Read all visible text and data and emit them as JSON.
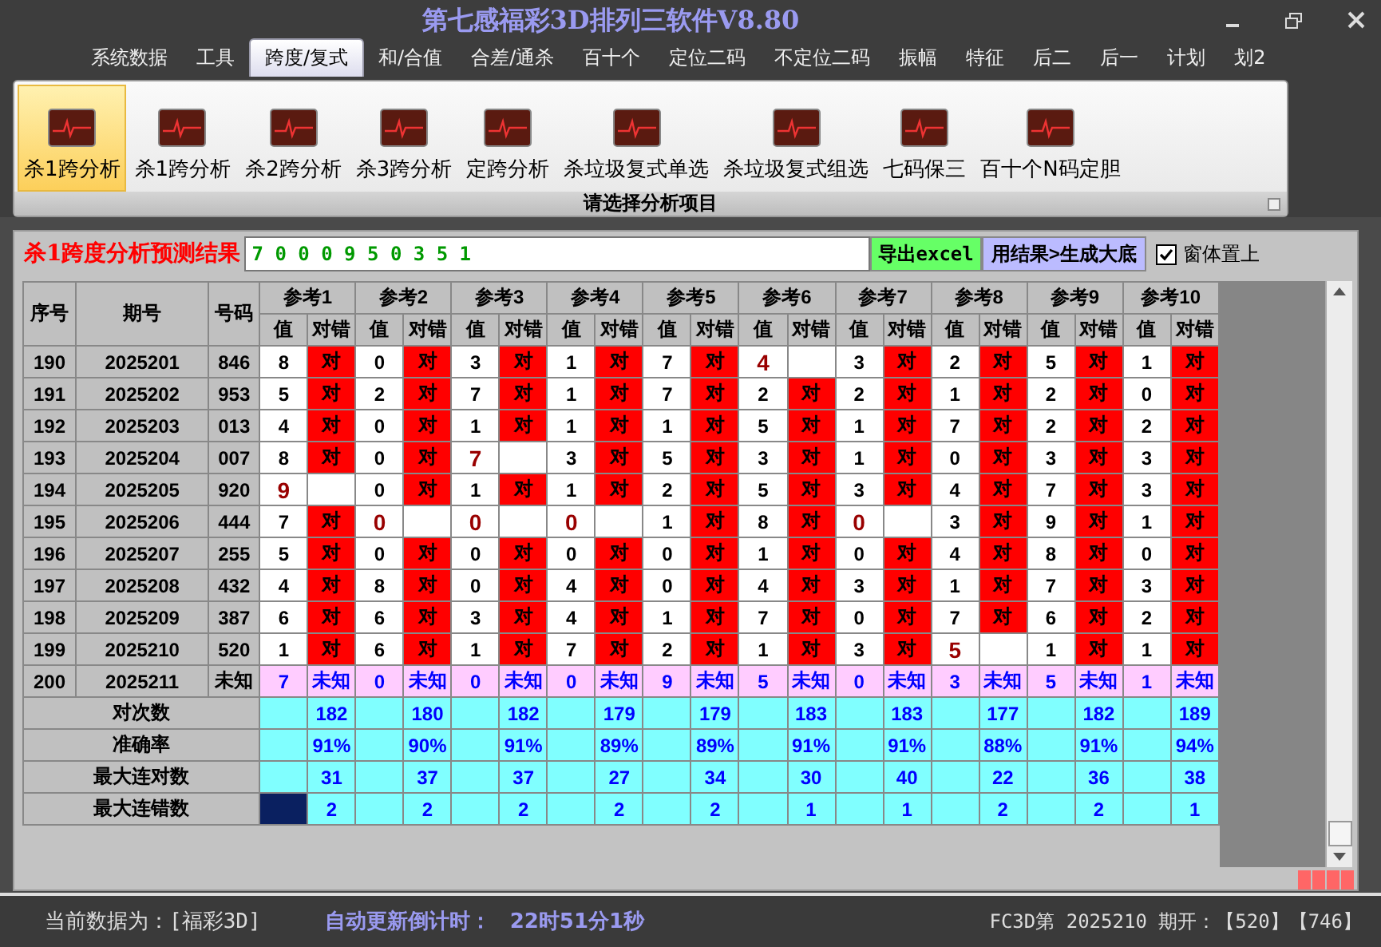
{
  "window": {
    "title": "第七感福彩3D排列三软件V8.80"
  },
  "menu": [
    {
      "label": "系统数据",
      "selected": false
    },
    {
      "label": "工具",
      "selected": false
    },
    {
      "label": "跨度/复式",
      "selected": true
    },
    {
      "label": "和/合值",
      "selected": false
    },
    {
      "label": "合差/通杀",
      "selected": false
    },
    {
      "label": "百十个",
      "selected": false
    },
    {
      "label": "定位二码",
      "selected": false
    },
    {
      "label": "不定位二码",
      "selected": false
    },
    {
      "label": "振幅",
      "selected": false
    },
    {
      "label": "特征",
      "selected": false
    },
    {
      "label": "后二",
      "selected": false
    },
    {
      "label": "后一",
      "selected": false
    },
    {
      "label": "计划",
      "selected": false
    },
    {
      "label": "划2",
      "selected": false
    }
  ],
  "ribbon": {
    "items": [
      {
        "label": "杀1跨分析",
        "selected": true
      },
      {
        "label": "杀1跨分析",
        "selected": false
      },
      {
        "label": "杀2跨分析",
        "selected": false
      },
      {
        "label": "杀3跨分析",
        "selected": false
      },
      {
        "label": "定跨分析",
        "selected": false
      },
      {
        "label": "杀垃圾复式单选",
        "selected": false
      },
      {
        "label": "杀垃圾复式组选",
        "selected": false
      },
      {
        "label": "七码保三",
        "selected": false
      },
      {
        "label": "百十个N码定胆",
        "selected": false
      }
    ],
    "group_label": "请选择分析项目"
  },
  "result": {
    "label": "杀1跨度分析预测结果",
    "value": "7 0 0 0 9 5 0 3 5 1",
    "export_button": "导出excel",
    "generate_button": "用结果>生成大底",
    "on_top": {
      "label": "窗体置上",
      "checked": true
    }
  },
  "table": {
    "columns": [
      "序号",
      "期号",
      "号码"
    ],
    "group_columns": [
      {
        "label": "参考1",
        "sub": [
          "值",
          "对错"
        ]
      },
      {
        "label": "参考2",
        "sub": [
          "值",
          "对错"
        ]
      },
      {
        "label": "参考3",
        "sub": [
          "值",
          "对错"
        ]
      },
      {
        "label": "参考4",
        "sub": [
          "值",
          "对错"
        ]
      },
      {
        "label": "参考5",
        "sub": [
          "值",
          "对错"
        ]
      },
      {
        "label": "参考6",
        "sub": [
          "值",
          "对错"
        ]
      },
      {
        "label": "参考7",
        "sub": [
          "值",
          "对错"
        ]
      },
      {
        "label": "参考8",
        "sub": [
          "值",
          "对错"
        ]
      },
      {
        "label": "参考9",
        "sub": [
          "值",
          "对错"
        ]
      },
      {
        "label": "参考10",
        "sub": [
          "值",
          "对错"
        ]
      }
    ],
    "rows": [
      {
        "seq": "190",
        "period": "2025201",
        "number": "846",
        "kind": "done",
        "cells": [
          {
            "v": "8",
            "mark": "对"
          },
          {
            "v": "0",
            "mark": "对"
          },
          {
            "v": "3",
            "mark": "对"
          },
          {
            "v": "1",
            "mark": "对"
          },
          {
            "v": "7",
            "mark": "对"
          },
          {
            "v": "4",
            "miss": true
          },
          {
            "v": "3",
            "mark": "对"
          },
          {
            "v": "2",
            "mark": "对"
          },
          {
            "v": "5",
            "mark": "对"
          },
          {
            "v": "1",
            "mark": "对"
          }
        ]
      },
      {
        "seq": "191",
        "period": "2025202",
        "number": "953",
        "kind": "done",
        "cells": [
          {
            "v": "5",
            "mark": "对"
          },
          {
            "v": "2",
            "mark": "对"
          },
          {
            "v": "7",
            "mark": "对"
          },
          {
            "v": "1",
            "mark": "对"
          },
          {
            "v": "7",
            "mark": "对"
          },
          {
            "v": "2",
            "mark": "对"
          },
          {
            "v": "2",
            "mark": "对"
          },
          {
            "v": "1",
            "mark": "对"
          },
          {
            "v": "2",
            "mark": "对"
          },
          {
            "v": "0",
            "mark": "对"
          }
        ]
      },
      {
        "seq": "192",
        "period": "2025203",
        "number": "013",
        "kind": "done",
        "cells": [
          {
            "v": "4",
            "mark": "对"
          },
          {
            "v": "0",
            "mark": "对"
          },
          {
            "v": "1",
            "mark": "对"
          },
          {
            "v": "1",
            "mark": "对"
          },
          {
            "v": "1",
            "mark": "对"
          },
          {
            "v": "5",
            "mark": "对"
          },
          {
            "v": "1",
            "mark": "对"
          },
          {
            "v": "7",
            "mark": "对"
          },
          {
            "v": "2",
            "mark": "对"
          },
          {
            "v": "2",
            "mark": "对"
          }
        ]
      },
      {
        "seq": "193",
        "period": "2025204",
        "number": "007",
        "kind": "done",
        "cells": [
          {
            "v": "8",
            "mark": "对"
          },
          {
            "v": "0",
            "mark": "对"
          },
          {
            "v": "7",
            "miss": true
          },
          {
            "v": "3",
            "mark": "对"
          },
          {
            "v": "5",
            "mark": "对"
          },
          {
            "v": "3",
            "mark": "对"
          },
          {
            "v": "1",
            "mark": "对"
          },
          {
            "v": "0",
            "mark": "对"
          },
          {
            "v": "3",
            "mark": "对"
          },
          {
            "v": "3",
            "mark": "对"
          }
        ]
      },
      {
        "seq": "194",
        "period": "2025205",
        "number": "920",
        "kind": "done",
        "cells": [
          {
            "v": "9",
            "miss": true
          },
          {
            "v": "0",
            "mark": "对"
          },
          {
            "v": "1",
            "mark": "对"
          },
          {
            "v": "1",
            "mark": "对"
          },
          {
            "v": "2",
            "mark": "对"
          },
          {
            "v": "5",
            "mark": "对"
          },
          {
            "v": "3",
            "mark": "对"
          },
          {
            "v": "4",
            "mark": "对"
          },
          {
            "v": "7",
            "mark": "对"
          },
          {
            "v": "3",
            "mark": "对"
          }
        ]
      },
      {
        "seq": "195",
        "period": "2025206",
        "number": "444",
        "kind": "done",
        "cells": [
          {
            "v": "7",
            "mark": "对"
          },
          {
            "v": "0",
            "miss": true
          },
          {
            "v": "0",
            "miss": true
          },
          {
            "v": "0",
            "miss": true
          },
          {
            "v": "1",
            "mark": "对"
          },
          {
            "v": "8",
            "mark": "对"
          },
          {
            "v": "0",
            "miss": true
          },
          {
            "v": "3",
            "mark": "对"
          },
          {
            "v": "9",
            "mark": "对"
          },
          {
            "v": "1",
            "mark": "对"
          }
        ]
      },
      {
        "seq": "196",
        "period": "2025207",
        "number": "255",
        "kind": "done",
        "cells": [
          {
            "v": "5",
            "mark": "对"
          },
          {
            "v": "0",
            "mark": "对"
          },
          {
            "v": "0",
            "mark": "对"
          },
          {
            "v": "0",
            "mark": "对"
          },
          {
            "v": "0",
            "mark": "对"
          },
          {
            "v": "1",
            "mark": "对"
          },
          {
            "v": "0",
            "mark": "对"
          },
          {
            "v": "4",
            "mark": "对"
          },
          {
            "v": "8",
            "mark": "对"
          },
          {
            "v": "0",
            "mark": "对"
          }
        ]
      },
      {
        "seq": "197",
        "period": "2025208",
        "number": "432",
        "kind": "done",
        "cells": [
          {
            "v": "4",
            "mark": "对"
          },
          {
            "v": "8",
            "mark": "对"
          },
          {
            "v": "0",
            "mark": "对"
          },
          {
            "v": "4",
            "mark": "对"
          },
          {
            "v": "0",
            "mark": "对"
          },
          {
            "v": "4",
            "mark": "对"
          },
          {
            "v": "3",
            "mark": "对"
          },
          {
            "v": "1",
            "mark": "对"
          },
          {
            "v": "7",
            "mark": "对"
          },
          {
            "v": "3",
            "mark": "对"
          }
        ]
      },
      {
        "seq": "198",
        "period": "2025209",
        "number": "387",
        "kind": "done",
        "cells": [
          {
            "v": "6",
            "mark": "对"
          },
          {
            "v": "6",
            "mark": "对"
          },
          {
            "v": "3",
            "mark": "对"
          },
          {
            "v": "4",
            "mark": "对"
          },
          {
            "v": "1",
            "mark": "对"
          },
          {
            "v": "7",
            "mark": "对"
          },
          {
            "v": "0",
            "mark": "对"
          },
          {
            "v": "7",
            "mark": "对"
          },
          {
            "v": "6",
            "mark": "对"
          },
          {
            "v": "2",
            "mark": "对"
          }
        ]
      },
      {
        "seq": "199",
        "period": "2025210",
        "number": "520",
        "kind": "done",
        "cells": [
          {
            "v": "1",
            "mark": "对"
          },
          {
            "v": "6",
            "mark": "对"
          },
          {
            "v": "1",
            "mark": "对"
          },
          {
            "v": "7",
            "mark": "对"
          },
          {
            "v": "2",
            "mark": "对"
          },
          {
            "v": "1",
            "mark": "对"
          },
          {
            "v": "3",
            "mark": "对"
          },
          {
            "v": "5",
            "miss": true
          },
          {
            "v": "1",
            "mark": "对"
          },
          {
            "v": "1",
            "mark": "对"
          }
        ]
      },
      {
        "seq": "200",
        "period": "2025211",
        "number": "未知",
        "kind": "pending",
        "cells": [
          {
            "v": "7",
            "mark": "未知"
          },
          {
            "v": "0",
            "mark": "未知"
          },
          {
            "v": "0",
            "mark": "未知"
          },
          {
            "v": "0",
            "mark": "未知"
          },
          {
            "v": "9",
            "mark": "未知"
          },
          {
            "v": "5",
            "mark": "未知"
          },
          {
            "v": "0",
            "mark": "未知"
          },
          {
            "v": "3",
            "mark": "未知"
          },
          {
            "v": "5",
            "mark": "未知"
          },
          {
            "v": "1",
            "mark": "未知"
          }
        ]
      }
    ],
    "stats": [
      {
        "label": "对次数",
        "selected": false,
        "values": [
          "182",
          "180",
          "182",
          "179",
          "179",
          "183",
          "183",
          "177",
          "182",
          "189"
        ]
      },
      {
        "label": "准确率",
        "selected": false,
        "values": [
          "91%",
          "90%",
          "91%",
          "89%",
          "89%",
          "91%",
          "91%",
          "88%",
          "91%",
          "94%"
        ]
      },
      {
        "label": "最大连对数",
        "selected": false,
        "values": [
          "31",
          "37",
          "37",
          "27",
          "34",
          "30",
          "40",
          "22",
          "36",
          "38"
        ]
      },
      {
        "label": "最大连错数",
        "selected": true,
        "values": [
          "2",
          "2",
          "2",
          "2",
          "2",
          "1",
          "1",
          "2",
          "2",
          "1"
        ]
      }
    ]
  },
  "status_bar": {
    "data_source": "当前数据为：[福彩3D]",
    "countdown_label": "自动更新倒计时：",
    "countdown": "22时51分1秒",
    "draw_info": "FC3D第 2025210 期开：【520】【746】"
  }
}
